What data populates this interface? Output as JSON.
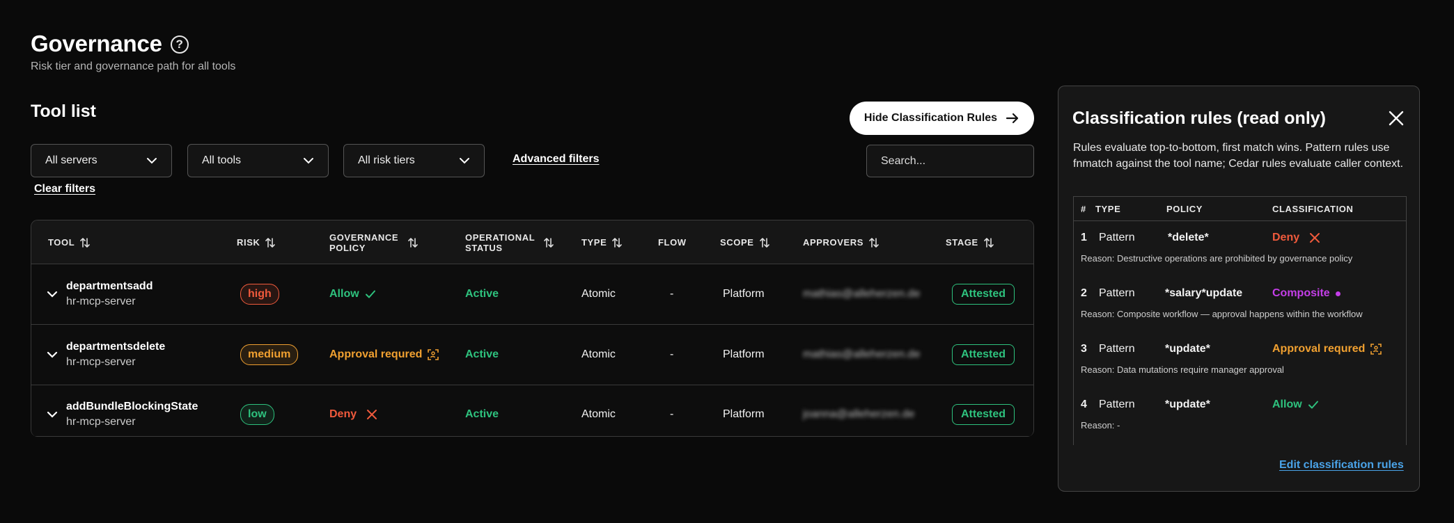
{
  "header": {
    "title": "Governance",
    "subtitle": "Risk tier and governance path for all tools"
  },
  "toolbar": {
    "section_title": "Tool list",
    "hide_rules_label": "Hide Classification Rules",
    "filters": [
      "All servers",
      "All tools",
      "All risk tiers"
    ],
    "advanced_filters": "Advanced filters",
    "clear_filters": "Clear filters",
    "search_placeholder": "Search..."
  },
  "table": {
    "columns": [
      "TOOL",
      "RISK",
      "GOVERNANCE POLICY",
      "OPERATIONAL STATUS",
      "TYPE",
      "FLOW",
      "SCOPE",
      "APPROVERS",
      "STAGE"
    ],
    "rows": [
      {
        "tool": "departmentsadd",
        "server": "hr-mcp-server",
        "risk": "high",
        "policy": "Allow",
        "status": "Active",
        "type": "Atomic",
        "flow": "-",
        "scope": "Platform",
        "approver": "mathias@alleherzen.de",
        "stage": "Attested"
      },
      {
        "tool": "departmentsdelete",
        "server": "hr-mcp-server",
        "risk": "medium",
        "policy": "Approval requred",
        "status": "Active",
        "type": "Atomic",
        "flow": "-",
        "scope": "Platform",
        "approver": "mathias@alleherzen.de",
        "stage": "Attested"
      },
      {
        "tool": "addBundleBlockingState",
        "server": "hr-mcp-server",
        "risk": "low",
        "policy": "Deny",
        "status": "Active",
        "type": "Atomic",
        "flow": "-",
        "scope": "Platform",
        "approver": "joanna@alleherzen.de",
        "stage": "Attested"
      }
    ]
  },
  "panel": {
    "title": "Classification rules (read only)",
    "description": "Rules evaluate top-to-bottom, first match wins. Pattern rules use fnmatch against the tool name; Cedar rules evaluate caller context.",
    "columns": [
      "#",
      "TYPE",
      "POLICY",
      "CLASSIFICATION"
    ],
    "rules": [
      {
        "num": "1",
        "type": "Pattern",
        "policy": "*delete*",
        "classification": "Deny",
        "reason": "Reason: Destructive operations are prohibited by governance policy"
      },
      {
        "num": "2",
        "type": "Pattern",
        "policy": "*salary*update",
        "classification": "Composite",
        "reason": "Reason: Composite workflow — approval happens within the workflow"
      },
      {
        "num": "3",
        "type": "Pattern",
        "policy": "*update*",
        "classification": "Approval requred",
        "reason": "Reason: Data mutations require manager approval"
      },
      {
        "num": "4",
        "type": "Pattern",
        "policy": "*update*",
        "classification": "Allow",
        "reason": "Reason: -"
      }
    ],
    "edit_link": "Edit classification rules"
  },
  "colors": {
    "green": "#2ec27e",
    "orange": "#f0a030",
    "red": "#f05a3c",
    "purple": "#c43ee8",
    "link": "#4aa3e8"
  }
}
